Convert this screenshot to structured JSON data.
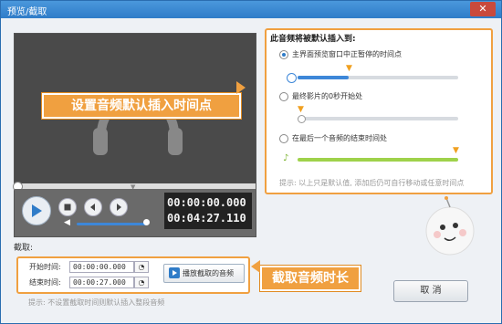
{
  "window": {
    "title": "预览/截取",
    "close_label": "✕"
  },
  "player": {
    "current_time": "00:00:00.000",
    "total_time": "00:04:27.110",
    "volume_fraction": 0.95,
    "icons": [
      "play-icon",
      "stop-icon",
      "prev-icon",
      "next-icon",
      "volume-icon",
      "headphones-icon"
    ]
  },
  "callouts": {
    "insert_point": "设置音频默认插入时间点",
    "cut_length": "截取音频时长"
  },
  "insert": {
    "title": "此音频将被默认插入到:",
    "options": [
      {
        "label": "主界面预览窗口中正暂停的时间点",
        "selected": true
      },
      {
        "label": "最终影片的0秒开始处",
        "selected": false
      },
      {
        "label": "在最后一个音频的结束时间处",
        "selected": false
      }
    ],
    "hint": "提示: 以上只是默认值, 添加后仍可自行移动或任意时间点"
  },
  "cut": {
    "section_label": "截取:",
    "start_label": "开始时间:",
    "start_value": "00:00:00.000",
    "end_label": "结束时间:",
    "end_value": "00:00:27.000",
    "play_button": "播放截取的音频",
    "hint": "提示: 不设置截取时间则默认插入整段音频"
  },
  "cancel_button": "取 消",
  "colors": {
    "accent": "#2f7cc8",
    "highlight": "#f0a040",
    "slider": "#3d87d8"
  }
}
